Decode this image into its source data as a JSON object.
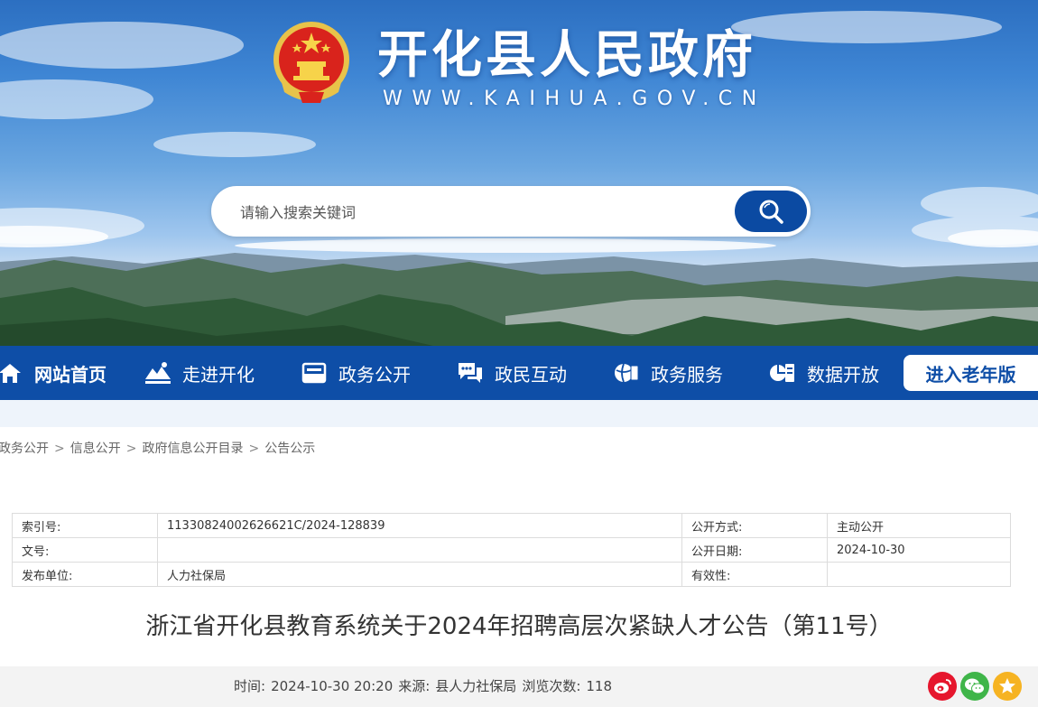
{
  "header": {
    "site_title": "开化县人民政府",
    "site_domain": "WWW.KAIHUA.GOV.CN",
    "search_placeholder": "请输入搜索关键词"
  },
  "nav": {
    "items": [
      {
        "label": "网站首页",
        "icon": "home-icon"
      },
      {
        "label": "走进开化",
        "icon": "landscape-icon"
      },
      {
        "label": "政务公开",
        "icon": "document-tray-icon"
      },
      {
        "label": "政民互动",
        "icon": "chat-bubbles-icon"
      },
      {
        "label": "政务服务",
        "icon": "globe-service-icon"
      },
      {
        "label": "数据开放",
        "icon": "data-server-icon"
      }
    ],
    "elder_mode_label": "进入老年版"
  },
  "breadcrumb": [
    "政务公开",
    "信息公开",
    "政府信息公开目录",
    "公告公示"
  ],
  "info_table": {
    "index_label": "索引号:",
    "index_value": "11330824002626621C/2024-128839",
    "method_label": "公开方式:",
    "method_value": "主动公开",
    "doc_no_label": "文号:",
    "doc_no_value": "",
    "date_label": "公开日期:",
    "date_value": "2024-10-30",
    "publisher_label": "发布单位:",
    "publisher_value": "人力社保局",
    "validity_label": "有效性:",
    "validity_value": ""
  },
  "article": {
    "title": "浙江省开化县教育系统关于2024年招聘高层次紧缺人才公告（第11号）",
    "time_label": "时间:",
    "time_value": "2024-10-30 20:20",
    "source_label": "来源:",
    "source_value": "县人力社保局",
    "views_label": "浏览次数:",
    "views_value": "118"
  },
  "share": {
    "icons": [
      "weibo-icon",
      "wechat-icon",
      "favorite-icon"
    ],
    "colors": {
      "weibo": "#e6162d",
      "wechat": "#3fb549",
      "favorite": "#f6b322"
    }
  },
  "colors": {
    "nav_bg": "#0e4ea7",
    "search_button": "#0b4aa2"
  }
}
